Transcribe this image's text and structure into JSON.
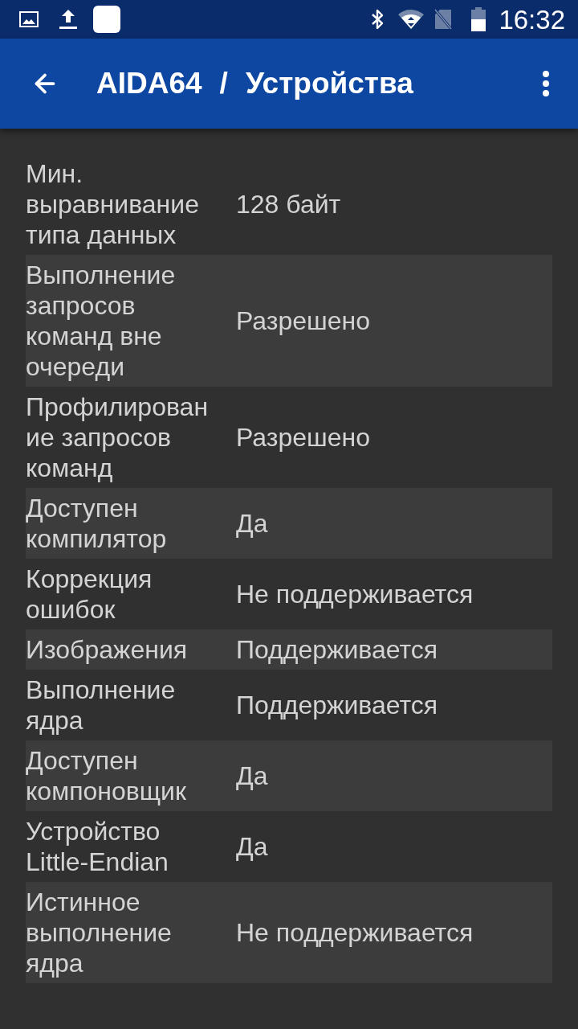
{
  "status_bar": {
    "time": "16:32"
  },
  "app_bar": {
    "app_name": "AIDA64",
    "separator": "/",
    "page_title": "Устройства"
  },
  "rows": [
    {
      "label": "Мин. выравнивание типа данных",
      "value": "128 байт"
    },
    {
      "label": "Выполнение запросов команд вне очереди",
      "value": "Разрешено"
    },
    {
      "label": "Профилирование запросов команд",
      "value": "Разрешено"
    },
    {
      "label": "Доступен компилятор",
      "value": "Да"
    },
    {
      "label": "Коррекция ошибок",
      "value": "Не поддерживается"
    },
    {
      "label": "Изображения",
      "value": "Поддерживается"
    },
    {
      "label": "Выполнение ядра",
      "value": "Поддерживается"
    },
    {
      "label": "Доступен компоновщик",
      "value": "Да"
    },
    {
      "label": "Устройство Little-Endian",
      "value": "Да"
    },
    {
      "label": "Истинное выполнение ядра",
      "value": "Не поддерживается"
    }
  ]
}
